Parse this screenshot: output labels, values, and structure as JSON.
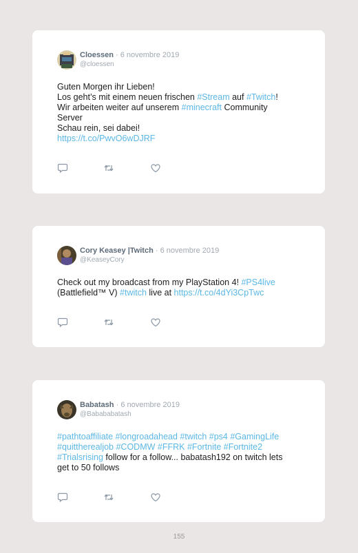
{
  "tweets": [
    {
      "name": "Cloessen",
      "separator": "·",
      "date": "6 novembre 2019",
      "handle": "@cloessen",
      "lines": [
        [
          {
            "t": "Guten Morgen ihr Lieben!",
            "k": "text"
          }
        ],
        [
          {
            "t": "Los geht’s mit einem neuen frischen ",
            "k": "text"
          },
          {
            "t": "#Stream",
            "k": "tag"
          },
          {
            "t": " auf ",
            "k": "text"
          },
          {
            "t": "#Twitch",
            "k": "tag"
          },
          {
            "t": "!",
            "k": "text"
          }
        ],
        [
          {
            "t": "Wir arbeiten weiter auf unserem ",
            "k": "text"
          },
          {
            "t": "#minecraft",
            "k": "tag"
          },
          {
            "t": " Community",
            "k": "text"
          }
        ],
        [
          {
            "t": "Server",
            "k": "text"
          }
        ],
        [
          {
            "t": "Schau rein, sei dabei!",
            "k": "text"
          }
        ],
        [
          {
            "t": "https://t.co/PwvO6wDJRF",
            "k": "link"
          }
        ]
      ],
      "avatar_colors": [
        "#3d3f49",
        "#e0c48e",
        "#4c7a9b"
      ]
    },
    {
      "name": "Cory Keasey |Twitch",
      "separator": "·",
      "date": "6 novembre 2019",
      "handle": "@KeaseyCory",
      "lines": [
        [
          {
            "t": "Check out my broadcast from my PlayStation 4! ",
            "k": "text"
          },
          {
            "t": "#PS4live",
            "k": "tag"
          }
        ],
        [
          {
            "t": "(Battlefield™ V) ",
            "k": "text"
          },
          {
            "t": "#twitch",
            "k": "tag"
          },
          {
            "t": " live at ",
            "k": "text"
          },
          {
            "t": "https://t.co/4dYi3CpTwc",
            "k": "link"
          }
        ]
      ],
      "avatar_colors": [
        "#4a3f2a",
        "#7b5e3c",
        "#5a4e8e"
      ]
    },
    {
      "name": "Babatash",
      "separator": "·",
      "date": "6 novembre 2019",
      "handle": "@Babababatash",
      "lines": [
        [
          {
            "t": "#pathtoaffiliate #longroadahead #twitch #ps4 #GamingLife",
            "k": "tag"
          }
        ],
        [
          {
            "t": "#quittherealjob #CODMW #FFRK #Fortnite #Fortnite2",
            "k": "tag"
          }
        ],
        [
          {
            "t": "#Trialsrising",
            "k": "tag"
          },
          {
            "t": " follow for a follow... babatash192 on twitch lets",
            "k": "text"
          }
        ],
        [
          {
            "t": "get to 50 follows",
            "k": "text"
          }
        ]
      ],
      "avatar_colors": [
        "#5a4a30",
        "#9a7a50",
        "#3b3428"
      ]
    }
  ],
  "page_number": "155",
  "colors": {
    "background": "#ebe6e6",
    "card": "#ffffff",
    "name": "#5d6b79",
    "muted": "#a0a8b1",
    "hashtag": "#5bb7e5",
    "icon": "#8a96a3"
  },
  "action_icons": [
    "reply-icon",
    "retweet-icon",
    "like-icon"
  ]
}
